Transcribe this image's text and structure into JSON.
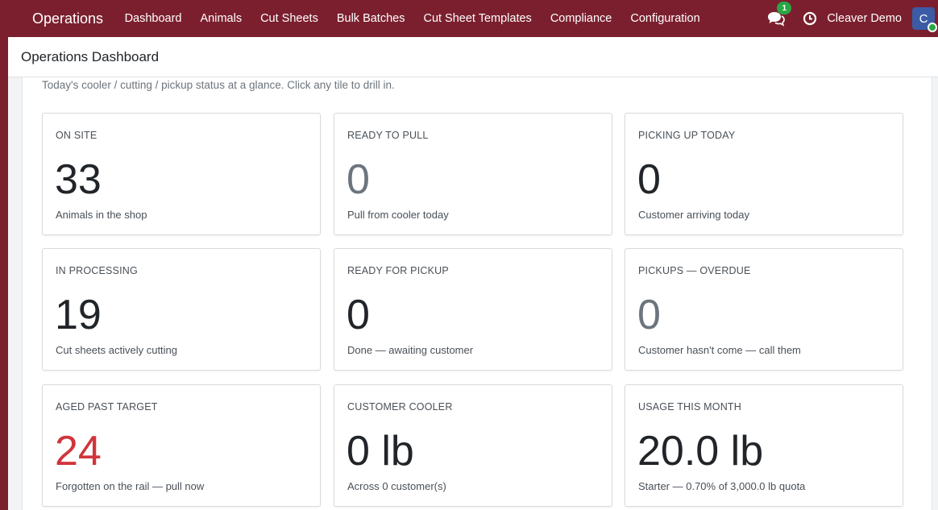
{
  "navbar": {
    "brand": "Operations",
    "menu": [
      "Dashboard",
      "Animals",
      "Cut Sheets",
      "Bulk Batches",
      "Cut Sheet Templates",
      "Compliance",
      "Configuration"
    ],
    "messages_count": "1",
    "user_name": "Cleaver Demo",
    "avatar_letter": "C"
  },
  "page": {
    "breadcrumb": "Operations Dashboard",
    "intro": "Today's cooler / cutting / pickup status at a glance. Click any tile to drill in."
  },
  "tiles": [
    {
      "label": "ON SITE",
      "value": "33",
      "sub": "Animals in the shop",
      "tone": "default"
    },
    {
      "label": "READY TO PULL",
      "value": "0",
      "sub": "Pull from cooler today",
      "tone": "muted"
    },
    {
      "label": "PICKING UP TODAY",
      "value": "0",
      "sub": "Customer arriving today",
      "tone": "default"
    },
    {
      "label": "IN PROCESSING",
      "value": "19",
      "sub": "Cut sheets actively cutting",
      "tone": "default"
    },
    {
      "label": "READY FOR PICKUP",
      "value": "0",
      "sub": "Done — awaiting customer",
      "tone": "default"
    },
    {
      "label": "PICKUPS — OVERDUE",
      "value": "0",
      "sub": "Customer hasn't come — call them",
      "tone": "muted"
    },
    {
      "label": "AGED PAST TARGET",
      "value": "24",
      "sub": "Forgotten on the rail — pull now",
      "tone": "danger"
    },
    {
      "label": "CUSTOMER COOLER",
      "value": "0 lb",
      "sub": "Across 0 customer(s)",
      "tone": "default"
    },
    {
      "label": "USAGE THIS MONTH",
      "value": "20.0 lb",
      "sub": "Starter — 0.70% of 3,000.0 lb quota",
      "tone": "default"
    }
  ],
  "colors": {
    "brand": "#7b1f2e",
    "muted_value": "#6c757d",
    "danger_value": "#d0353b",
    "badge": "#28a745"
  }
}
